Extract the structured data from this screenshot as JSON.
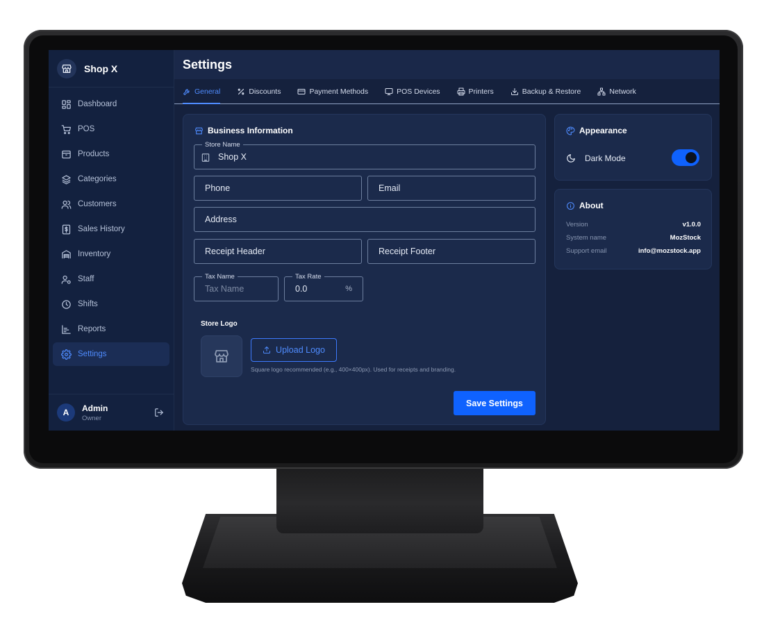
{
  "app": {
    "name": "Shop X"
  },
  "sidebar": {
    "items": [
      {
        "label": "Dashboard",
        "icon": "dashboard-icon"
      },
      {
        "label": "POS",
        "icon": "cart-icon"
      },
      {
        "label": "Products",
        "icon": "box-icon"
      },
      {
        "label": "Categories",
        "icon": "layers-icon"
      },
      {
        "label": "Customers",
        "icon": "users-icon"
      },
      {
        "label": "Sales History",
        "icon": "receipt-dollar-icon"
      },
      {
        "label": "Inventory",
        "icon": "warehouse-icon"
      },
      {
        "label": "Staff",
        "icon": "user-cog-icon"
      },
      {
        "label": "Shifts",
        "icon": "clock-icon"
      },
      {
        "label": "Reports",
        "icon": "chart-icon"
      },
      {
        "label": "Settings",
        "icon": "gear-icon",
        "active": true
      }
    ],
    "user": {
      "initial": "A",
      "name": "Admin",
      "role": "Owner"
    }
  },
  "page": {
    "title": "Settings"
  },
  "tabs": [
    {
      "label": "General",
      "icon": "wrench-icon",
      "active": true
    },
    {
      "label": "Discounts",
      "icon": "percent-icon"
    },
    {
      "label": "Payment Methods",
      "icon": "credit-card-icon"
    },
    {
      "label": "POS Devices",
      "icon": "monitor-icon"
    },
    {
      "label": "Printers",
      "icon": "printer-icon"
    },
    {
      "label": "Backup & Restore",
      "icon": "download-icon"
    },
    {
      "label": "Network",
      "icon": "network-icon"
    }
  ],
  "business": {
    "title": "Business Information",
    "store_name_label": "Store Name",
    "store_name_value": "Shop X",
    "phone_label": "Phone",
    "email_label": "Email",
    "address_label": "Address",
    "receipt_header_label": "Receipt Header",
    "receipt_footer_label": "Receipt Footer",
    "tax_name_label": "Tax Name",
    "tax_name_placeholder": "Tax Name",
    "tax_rate_label": "Tax Rate",
    "tax_rate_value": "0.0",
    "tax_rate_suffix": "%",
    "store_logo_label": "Store Logo",
    "upload_label": "Upload Logo",
    "logo_hint": "Square logo recommended (e.g., 400×400px). Used for receipts and branding.",
    "save_label": "Save Settings"
  },
  "appearance": {
    "title": "Appearance",
    "dark_mode_label": "Dark Mode",
    "dark_mode_on": true
  },
  "about": {
    "title": "About",
    "rows": [
      {
        "key": "Version",
        "value": "v1.0.0"
      },
      {
        "key": "System name",
        "value": "MozStock"
      },
      {
        "key": "Support email",
        "value": "info@mozstock.app"
      }
    ]
  },
  "colors": {
    "accent": "#0f62fe",
    "link": "#4f8cff",
    "sidebar": "#13213f",
    "card": "#1b2a4b"
  }
}
